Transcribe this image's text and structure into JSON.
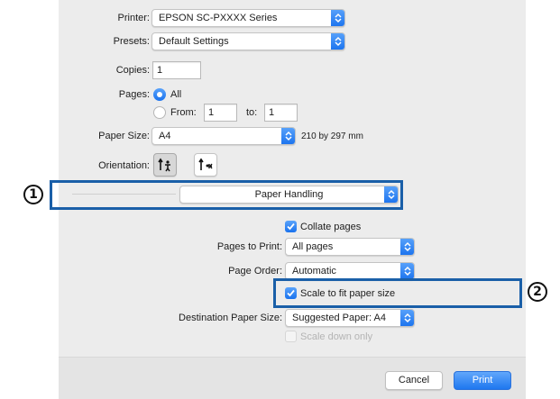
{
  "printer": {
    "label": "Printer:",
    "value": "EPSON SC-PXXXX Series"
  },
  "presets": {
    "label": "Presets:",
    "value": "Default Settings"
  },
  "copies": {
    "label": "Copies:",
    "value": "1"
  },
  "pages": {
    "label": "Pages:",
    "all_label": "All",
    "from_label": "From:",
    "from_value": "1",
    "to_label": "to:",
    "to_value": "1",
    "selected": "All"
  },
  "paper_size": {
    "label": "Paper Size:",
    "value": "A4",
    "dimensions": "210 by 297 mm"
  },
  "orientation": {
    "label": "Orientation:",
    "selected": "portrait"
  },
  "section": {
    "value": "Paper Handling"
  },
  "paper_handling": {
    "collate": {
      "label": "Collate pages",
      "checked": true
    },
    "pages_to_print": {
      "label": "Pages to Print:",
      "value": "All pages"
    },
    "page_order": {
      "label": "Page Order:",
      "value": "Automatic"
    },
    "scale_to_fit": {
      "label": "Scale to fit paper size",
      "checked": true
    },
    "destination": {
      "label": "Destination Paper Size:",
      "value": "Suggested Paper: A4"
    },
    "scale_down": {
      "label": "Scale down only",
      "checked": false,
      "enabled": false
    }
  },
  "buttons": {
    "cancel": "Cancel",
    "print": "Print"
  },
  "markers": {
    "one": "1",
    "two": "2"
  },
  "colors": {
    "accent": "#1a72ee",
    "callout": "#1a5fa8"
  }
}
